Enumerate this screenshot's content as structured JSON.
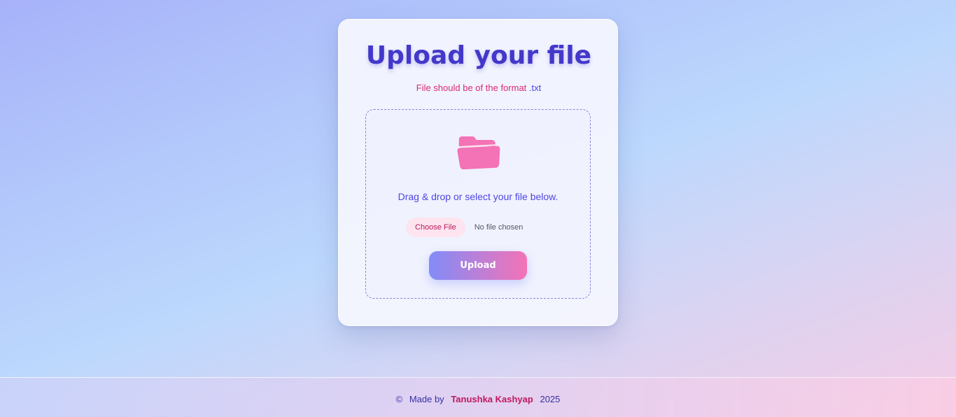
{
  "card": {
    "title": "Upload your file",
    "subtitle_prefix": "File should be of the format ",
    "subtitle_ext": ".txt"
  },
  "dropzone": {
    "icon": "folder-icon",
    "instruction": "Drag & drop or select your file below.",
    "choose_label": "Choose File",
    "file_status": "No file chosen",
    "upload_label": "Upload"
  },
  "footer": {
    "copyright": "©",
    "made_by": "Made by",
    "author": "Tanushka Kashyap",
    "year": "2025"
  },
  "colors": {
    "title": "#4338ca",
    "accent_pink": "#f472b6",
    "accent_indigo": "#818cf8",
    "subtitle": "#db2777"
  }
}
